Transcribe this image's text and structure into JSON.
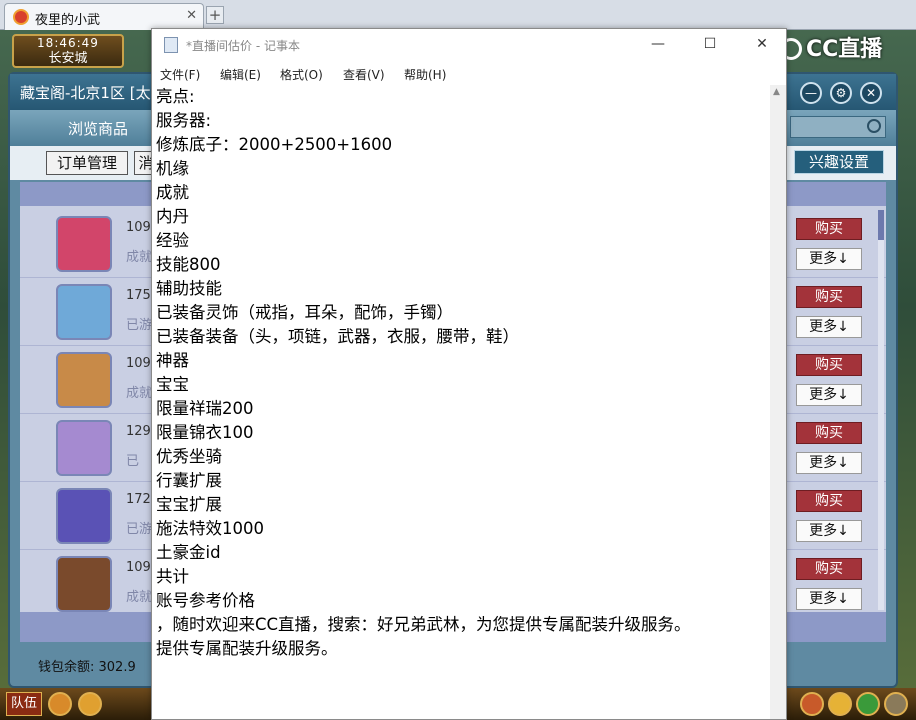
{
  "browser": {
    "tab_title": "夜里的小武",
    "tab_close": "✕",
    "new_tab": "+"
  },
  "game": {
    "clock_time": "18:46:49",
    "location": "长安城",
    "stream_logo": "CC直播",
    "bottom_team": "队伍"
  },
  "shop": {
    "title": "藏宝阁-北京1区 [太",
    "nav_browse": "浏览商品",
    "btn_orders": "订单管理",
    "btn_msg": "消",
    "btn_interest": "兴趣设置",
    "wallet": "钱包余额: 302.9",
    "rows": [
      {
        "price": "109",
        "status": "成就",
        "buy": "购买",
        "more": "更多↓",
        "avatar_color": "#d2456a"
      },
      {
        "price": "175",
        "status": "已游",
        "buy": "购买",
        "more": "更多↓",
        "avatar_color": "#6fa9d8"
      },
      {
        "price": "109",
        "status": "成就",
        "buy": "购买",
        "more": "更多↓",
        "avatar_color": "#c88a48"
      },
      {
        "price": "129",
        "status": "已",
        "buy": "购买",
        "more": "更多↓",
        "avatar_color": "#a58ad0"
      },
      {
        "price": "172",
        "status": "已游",
        "buy": "购买",
        "more": "更多↓",
        "avatar_color": "#5a52b5"
      },
      {
        "price": "109",
        "status": "成就",
        "buy": "购买",
        "more": "更多↓",
        "avatar_color": "#7a4a2c"
      }
    ]
  },
  "notepad": {
    "title": "*直播间估价 - 记事本",
    "minimize": "—",
    "maximize": "☐",
    "close": "✕",
    "menu": [
      "文件(F)",
      "编辑(E)",
      "格式(O)",
      "查看(V)",
      "帮助(H)"
    ],
    "lines": [
      "亮点:",
      "服务器:",
      "修炼底子：2000+2500+1600",
      "机缘",
      "成就",
      "内丹",
      "经验",
      "技能800",
      "辅助技能",
      "已装备灵饰（戒指，耳朵，配饰，手镯）",
      "已装备装备（头，项链，武器，衣服，腰带，鞋）",
      "神器",
      "宝宝",
      "限量祥瑞200",
      "限量锦衣100",
      "优秀坐骑",
      "行囊扩展",
      "宝宝扩展",
      "施法特效1000",
      "土豪金id",
      "共计",
      "账号参考价格",
      "，随时欢迎来CC直播，搜索：好兄弟武林，为您提供专属配装升级服务。",
      "提供专属配装升级服务。"
    ]
  }
}
